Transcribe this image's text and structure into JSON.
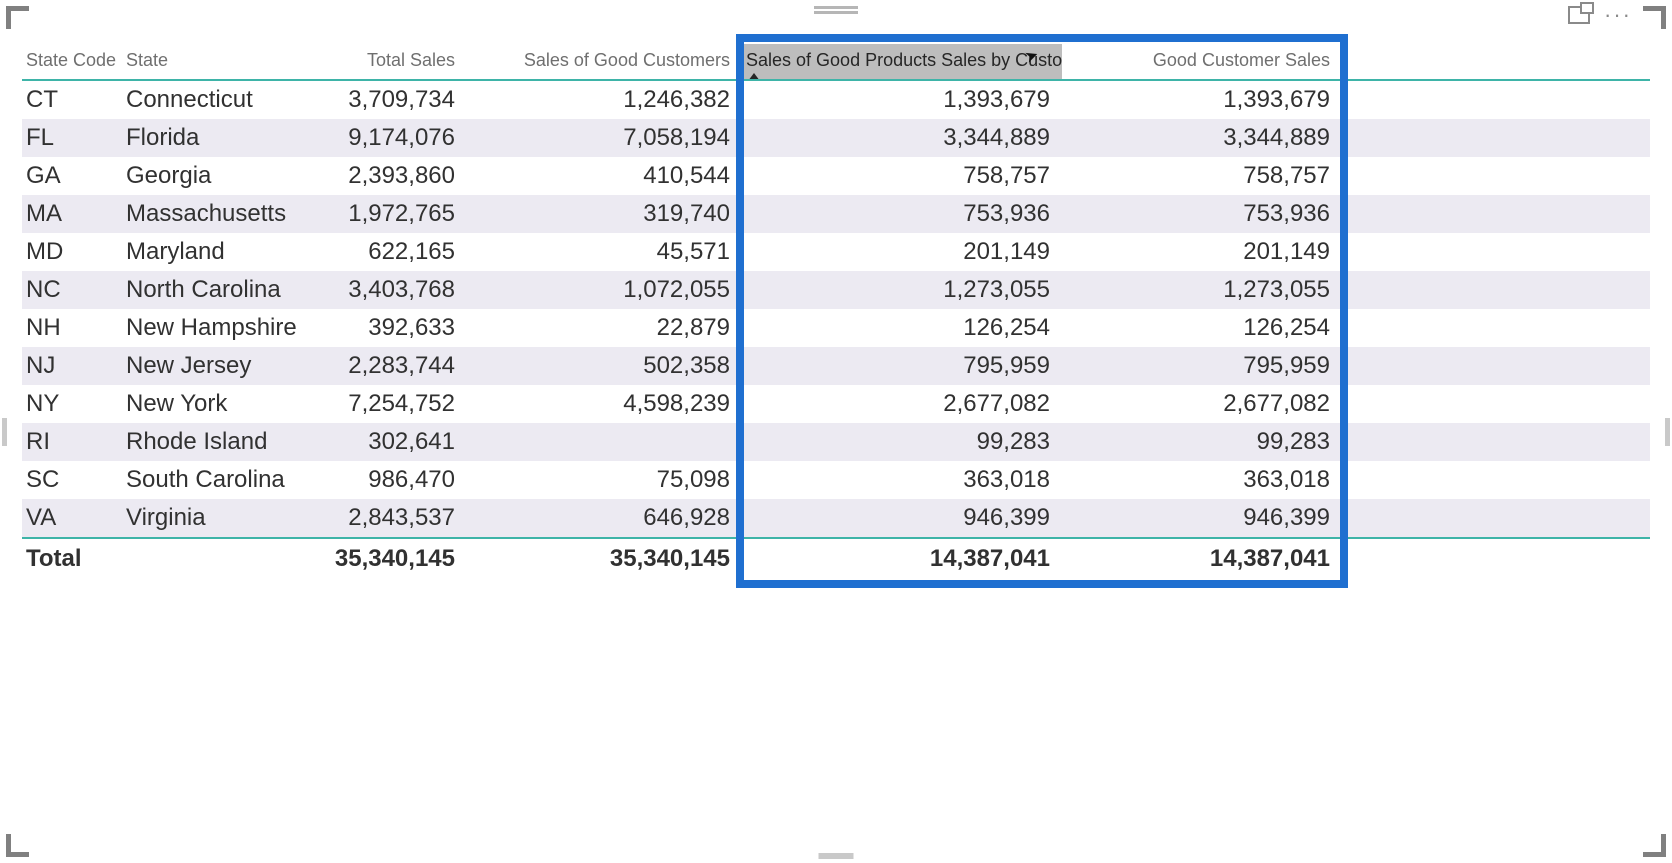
{
  "headers": {
    "state_code": "State Code",
    "state": "State",
    "total_sales": "Total Sales",
    "sales_good_customers": "Sales of Good Customers",
    "sales_good_products_by_customer": "Sales of Good Products Sales by Customer",
    "good_customer_sales": "Good Customer Sales"
  },
  "rows": [
    {
      "code": "CT",
      "state": "Connecticut",
      "total": "3,709,734",
      "good": "1,246,382",
      "prod": "1,393,679",
      "cust": "1,393,679"
    },
    {
      "code": "FL",
      "state": "Florida",
      "total": "9,174,076",
      "good": "7,058,194",
      "prod": "3,344,889",
      "cust": "3,344,889"
    },
    {
      "code": "GA",
      "state": "Georgia",
      "total": "2,393,860",
      "good": "410,544",
      "prod": "758,757",
      "cust": "758,757"
    },
    {
      "code": "MA",
      "state": "Massachusetts",
      "total": "1,972,765",
      "good": "319,740",
      "prod": "753,936",
      "cust": "753,936"
    },
    {
      "code": "MD",
      "state": "Maryland",
      "total": "622,165",
      "good": "45,571",
      "prod": "201,149",
      "cust": "201,149"
    },
    {
      "code": "NC",
      "state": "North Carolina",
      "total": "3,403,768",
      "good": "1,072,055",
      "prod": "1,273,055",
      "cust": "1,273,055"
    },
    {
      "code": "NH",
      "state": "New Hampshire",
      "total": "392,633",
      "good": "22,879",
      "prod": "126,254",
      "cust": "126,254"
    },
    {
      "code": "NJ",
      "state": "New Jersey",
      "total": "2,283,744",
      "good": "502,358",
      "prod": "795,959",
      "cust": "795,959"
    },
    {
      "code": "NY",
      "state": "New York",
      "total": "7,254,752",
      "good": "4,598,239",
      "prod": "2,677,082",
      "cust": "2,677,082"
    },
    {
      "code": "RI",
      "state": "Rhode Island",
      "total": "302,641",
      "good": "",
      "prod": "99,283",
      "cust": "99,283"
    },
    {
      "code": "SC",
      "state": "South Carolina",
      "total": "986,470",
      "good": "75,098",
      "prod": "363,018",
      "cust": "363,018"
    },
    {
      "code": "VA",
      "state": "Virginia",
      "total": "2,843,537",
      "good": "646,928",
      "prod": "946,399",
      "cust": "946,399"
    }
  ],
  "totals": {
    "label": "Total",
    "total": "35,340,145",
    "good": "35,340,145",
    "prod": "14,387,041",
    "cust": "14,387,041"
  },
  "chart_data": {
    "type": "table",
    "columns": [
      "State Code",
      "State",
      "Total Sales",
      "Sales of Good Customers",
      "Sales of Good Products Sales by Customer",
      "Good Customer Sales"
    ],
    "rows": [
      [
        "CT",
        "Connecticut",
        3709734,
        1246382,
        1393679,
        1393679
      ],
      [
        "FL",
        "Florida",
        9174076,
        7058194,
        3344889,
        3344889
      ],
      [
        "GA",
        "Georgia",
        2393860,
        410544,
        758757,
        758757
      ],
      [
        "MA",
        "Massachusetts",
        1972765,
        319740,
        753936,
        753936
      ],
      [
        "MD",
        "Maryland",
        622165,
        45571,
        201149,
        201149
      ],
      [
        "NC",
        "North Carolina",
        3403768,
        1072055,
        1273055,
        1273055
      ],
      [
        "NH",
        "New Hampshire",
        392633,
        22879,
        126254,
        126254
      ],
      [
        "NJ",
        "New Jersey",
        2283744,
        502358,
        795959,
        795959
      ],
      [
        "NY",
        "New York",
        7254752,
        4598239,
        2677082,
        2677082
      ],
      [
        "RI",
        "Rhode Island",
        302641,
        null,
        99283,
        99283
      ],
      [
        "SC",
        "South Carolina",
        986470,
        75098,
        363018,
        363018
      ],
      [
        "VA",
        "Virginia",
        2843537,
        646928,
        946399,
        946399
      ]
    ],
    "totals": [
      "Total",
      "",
      35340145,
      35340145,
      14387041,
      14387041
    ]
  }
}
